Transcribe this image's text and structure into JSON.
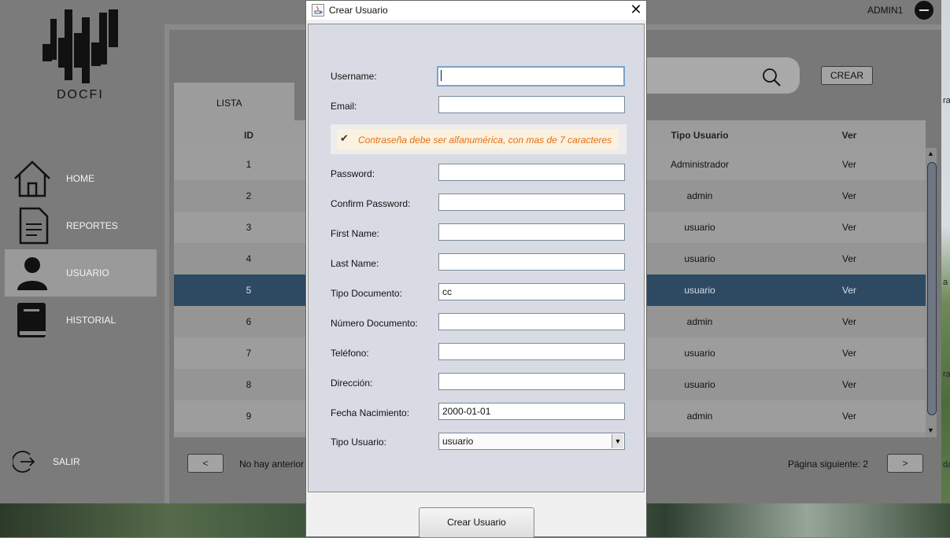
{
  "app": {
    "user_label": "ADMIN1",
    "logo_text": "DOCFI",
    "sidebar": [
      {
        "label": "HOME",
        "icon": "home-icon"
      },
      {
        "label": "REPORTES",
        "icon": "document-icon"
      },
      {
        "label": "USUARIO",
        "icon": "user-icon",
        "active": true
      },
      {
        "label": "HISTORIAL",
        "icon": "book-icon"
      }
    ],
    "salir_label": "SALIR",
    "crear_label": "CREAR",
    "tab_label": "LISTA",
    "table": {
      "headers": [
        "ID",
        "Tipo Usuario",
        "Ver"
      ],
      "rows": [
        {
          "id": "1",
          "tipo": "Administrador",
          "ver": "Ver"
        },
        {
          "id": "2",
          "tipo": "admin",
          "ver": "Ver"
        },
        {
          "id": "3",
          "tipo": "usuario",
          "ver": "Ver"
        },
        {
          "id": "4",
          "tipo": "usuario",
          "ver": "Ver"
        },
        {
          "id": "5",
          "tipo": "usuario",
          "ver": "Ver",
          "selected": true
        },
        {
          "id": "6",
          "tipo": "admin",
          "ver": "Ver"
        },
        {
          "id": "7",
          "tipo": "usuario",
          "ver": "Ver"
        },
        {
          "id": "8",
          "tipo": "usuario",
          "ver": "Ver"
        },
        {
          "id": "9",
          "tipo": "admin",
          "ver": "Ver"
        }
      ]
    },
    "pagination": {
      "prev_label": "<",
      "next_label": ">",
      "no_prev_text": "No hay anterior",
      "next_page_text": "Página siguiente: 2"
    },
    "right_edge_text": [
      "ra",
      "a",
      "ra",
      "da"
    ]
  },
  "dialog": {
    "title": "Crear Usuario",
    "close_label": "✕",
    "hint": "Contraseña debe ser alfanumérica, con mas de 7 caracteres",
    "fields": {
      "username": {
        "label": "Username:",
        "value": ""
      },
      "email": {
        "label": "Email:",
        "value": ""
      },
      "password": {
        "label": "Password:",
        "value": ""
      },
      "confirm_password": {
        "label": "Confirm Password:",
        "value": ""
      },
      "first_name": {
        "label": "First Name:",
        "value": ""
      },
      "last_name": {
        "label": "Last Name:",
        "value": ""
      },
      "tipo_documento": {
        "label": "Tipo Documento:",
        "value": "cc"
      },
      "numero_documento": {
        "label": "Número Documento:",
        "value": ""
      },
      "telefono": {
        "label": "Teléfono:",
        "value": ""
      },
      "direccion": {
        "label": "Dirección:",
        "value": ""
      },
      "fecha_nacimiento": {
        "label": "Fecha Nacimiento:",
        "value": "2000-01-01"
      },
      "tipo_usuario": {
        "label": "Tipo Usuario:",
        "value": "usuario"
      }
    },
    "submit_label": "Crear Usuario"
  }
}
